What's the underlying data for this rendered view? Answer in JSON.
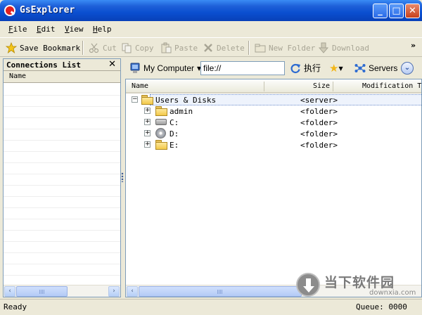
{
  "window": {
    "title": "GsExplorer",
    "min": "_",
    "max": "□",
    "close": "✕"
  },
  "menu": [
    {
      "label": "File",
      "key": "F",
      "rest": "ile"
    },
    {
      "label": "Edit",
      "key": "E",
      "rest": "dit"
    },
    {
      "label": "View",
      "key": "V",
      "rest": "iew"
    },
    {
      "label": "Help",
      "key": "H",
      "rest": "elp"
    }
  ],
  "toolbar": {
    "save_bookmark": "Save Bookmark",
    "cut": "Cut",
    "copy": "Copy",
    "paste": "Paste",
    "delete": "Delete",
    "new_folder": "New Folder",
    "download": "Download",
    "more": "»"
  },
  "connections": {
    "title": "Connections List",
    "close": "✕",
    "column_name": "Name"
  },
  "address": {
    "location_button": "My Computer",
    "path": "file://",
    "execute": "执行",
    "servers": "Servers",
    "expand": "»"
  },
  "files": {
    "columns": {
      "name": "Name",
      "size": "Size",
      "modified": "Modification T"
    },
    "rows": [
      {
        "name": "Users & Disks",
        "size": "<server>",
        "expander": "−",
        "icon": "folder-icon"
      },
      {
        "name": "admin",
        "size": "<folder>",
        "expander": "+",
        "icon": "folder-icon"
      },
      {
        "name": "C:",
        "size": "<folder>",
        "expander": "+",
        "icon": "hard-drive-icon"
      },
      {
        "name": "D:",
        "size": "<folder>",
        "expander": "+",
        "icon": "cd-drive-icon"
      },
      {
        "name": "E:",
        "size": "<folder>",
        "expander": "+",
        "icon": "folder-icon"
      }
    ]
  },
  "watermark": {
    "text": "当下软件园",
    "url": "downxia.com"
  },
  "status": {
    "text": "Ready",
    "queue": "Queue: 0000"
  },
  "scroll": {
    "left": "‹",
    "right": "›"
  }
}
